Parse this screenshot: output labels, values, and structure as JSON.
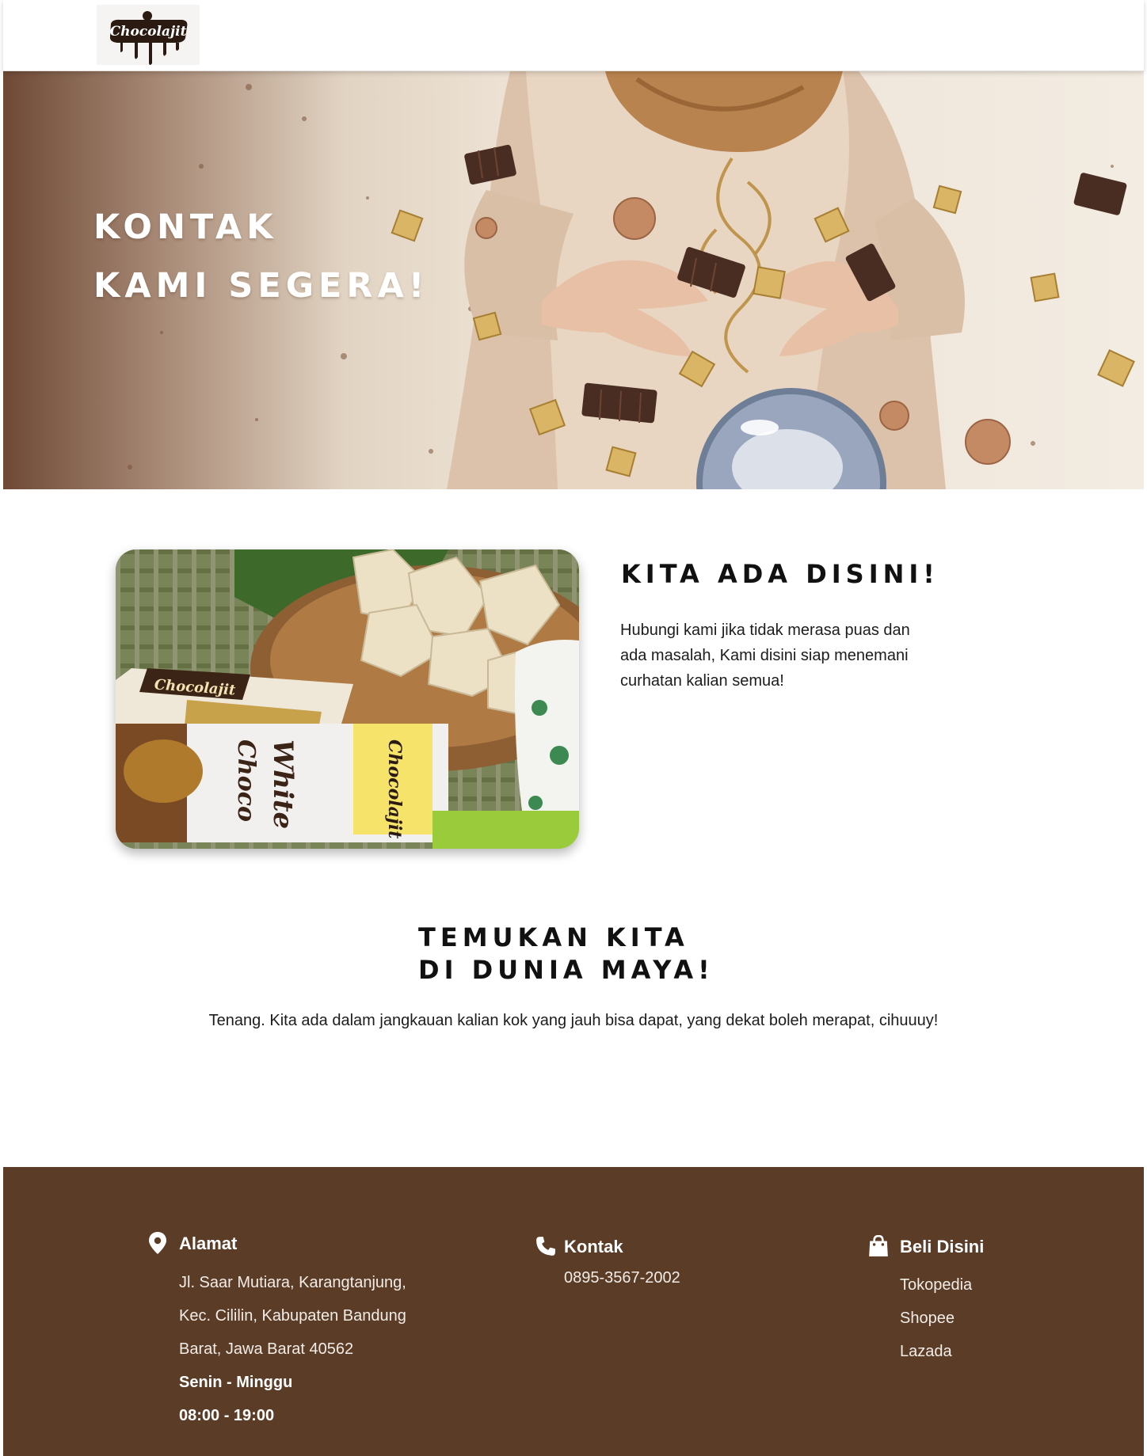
{
  "brand": {
    "logo_text": "Chocolajit"
  },
  "hero": {
    "title_line1": "KONTAK",
    "title_line2": "KAMI SEGERA!"
  },
  "about": {
    "title": "KITA ADA DISINI!",
    "text": "Hubungi kami jika  tidak merasa puas dan ada masalah, Kami disini  siap menemani curhatan kalian semua!"
  },
  "find": {
    "title_line1": "TEMUKAN KITA",
    "title_line2": "DI DUNIA MAYA!",
    "text": "Tenang. Kita ada dalam jangkauan kalian kok yang jauh bisa dapat, yang dekat boleh merapat, cihuuuy!"
  },
  "footer": {
    "address": {
      "icon": "location-pin-icon",
      "heading": "Alamat",
      "lines": [
        "Jl. Saar Mutiara, Karangtanjung,",
        "Kec. Cililin, Kabupaten Bandung",
        "Barat, Jawa Barat 40562"
      ],
      "days": "Senin - Minggu",
      "hours": "08:00 - 19:00"
    },
    "contact": {
      "icon": "phone-icon",
      "heading": "Kontak",
      "phone": "0895-3567-2002"
    },
    "shop": {
      "icon": "shopping-bag-icon",
      "heading": "Beli Disini",
      "links": [
        "Tokopedia",
        "Shopee",
        "Lazada"
      ]
    }
  },
  "colors": {
    "footer_bg": "#5b3c27",
    "hero_brown": "#6e4a36",
    "text_dark": "#111111"
  }
}
